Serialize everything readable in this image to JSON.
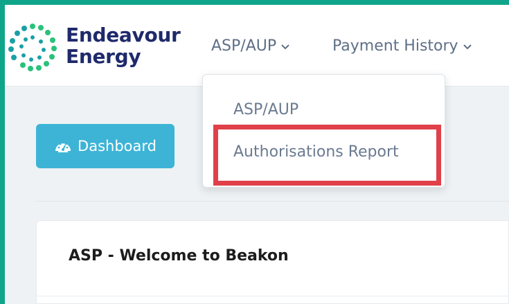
{
  "brand": {
    "line1": "Endeavour",
    "line2": "Energy"
  },
  "nav": {
    "asp_aup": "ASP/AUP",
    "payment_history": "Payment History"
  },
  "dropdown": {
    "items": [
      "ASP/AUP",
      "Authorisations Report"
    ]
  },
  "dashboard": {
    "label": "Dashboard"
  },
  "card": {
    "title": "ASP - Welcome to Beakon"
  },
  "colors": {
    "frame": "#0fa58a",
    "brand_text": "#1f2a6b",
    "dashboard_bg": "#3db4d6",
    "highlight": "#e0404a",
    "logo_green": "#29c27a",
    "logo_teal": "#1aa0a6"
  },
  "icons": [
    "logo-dots-icon",
    "chevron-down-icon",
    "gauge-icon"
  ]
}
